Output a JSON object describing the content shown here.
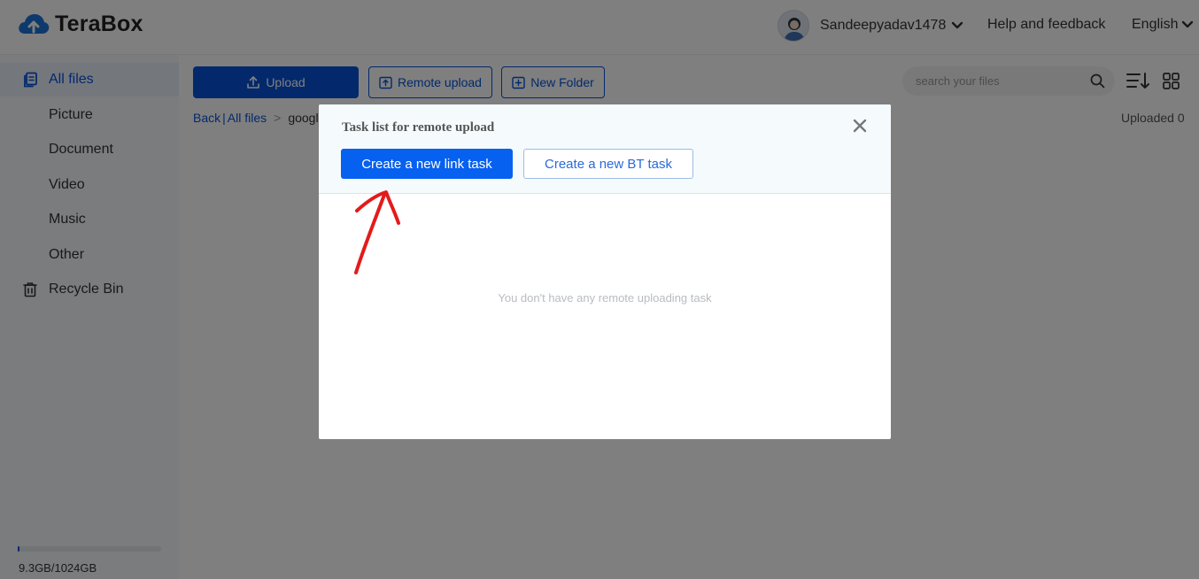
{
  "header": {
    "logo_text": "TeraBox",
    "username": "Sandeepyadav1478",
    "help": "Help and feedback",
    "language": "English"
  },
  "sidebar": {
    "items": [
      {
        "label": "All files",
        "icon": "all-files-icon",
        "active": true
      },
      {
        "label": "Picture"
      },
      {
        "label": "Document"
      },
      {
        "label": "Video"
      },
      {
        "label": "Music"
      },
      {
        "label": "Other"
      },
      {
        "label": "Recycle Bin",
        "icon": "trash-icon"
      }
    ],
    "storage": {
      "text": "9.3GB/1024GB",
      "used_fraction": 0.009
    }
  },
  "toolbar": {
    "upload_label": "Upload",
    "remote_upload_label": "Remote upload",
    "new_folder_label": "New Folder",
    "search_placeholder": "search your files"
  },
  "breadcrumb": {
    "back": "Back",
    "divider": "|",
    "all_files": "All files",
    "separator": ">",
    "current": "google"
  },
  "uploaded_text": "Uploaded 0",
  "modal": {
    "title": "Task list for remote upload",
    "create_link_task": "Create a new link task",
    "create_bt_task": "Create a new BT task",
    "empty_message": "You don't have any remote uploading task"
  },
  "colors": {
    "accent": "#0653d8",
    "primary_button": "#0660f0",
    "annotation": "#e31b1b"
  }
}
